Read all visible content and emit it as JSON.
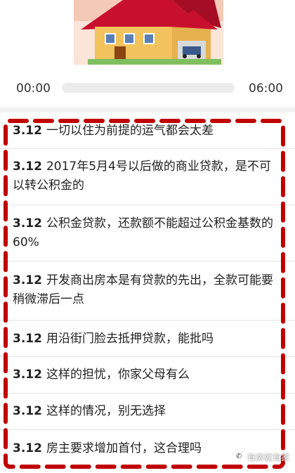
{
  "player": {
    "current_time": "00:00",
    "total_time": "06:00",
    "progress": 0
  },
  "list": {
    "items": [
      {
        "date": "3.12",
        "title": "一切以住为前提的运气都会太差"
      },
      {
        "date": "3.12",
        "title": "2017年5月4号以后做的商业贷款，是不可以转公积金的"
      },
      {
        "date": "3.12",
        "title": "公积金贷款，还款额不能超过公积金基数的60%"
      },
      {
        "date": "3.12",
        "title": "开发商出房本是有贷款的先出，全款可能要稍微滞后一点"
      },
      {
        "date": "3.12",
        "title": "用沿街门脸去抵押贷款，能批吗"
      },
      {
        "date": "3.12",
        "title": "这样的担忧，你家父母有么"
      },
      {
        "date": "3.12",
        "title": "这样的情况，别无选择"
      },
      {
        "date": "3.12",
        "title": "房主要求增加首付，这合理吗"
      }
    ]
  },
  "watermark": {
    "text": "有房就有家",
    "icon": "wechat-icon"
  },
  "colors": {
    "frame": "#c00000",
    "roof": "#c8102e",
    "wall": "#f2c25c"
  }
}
